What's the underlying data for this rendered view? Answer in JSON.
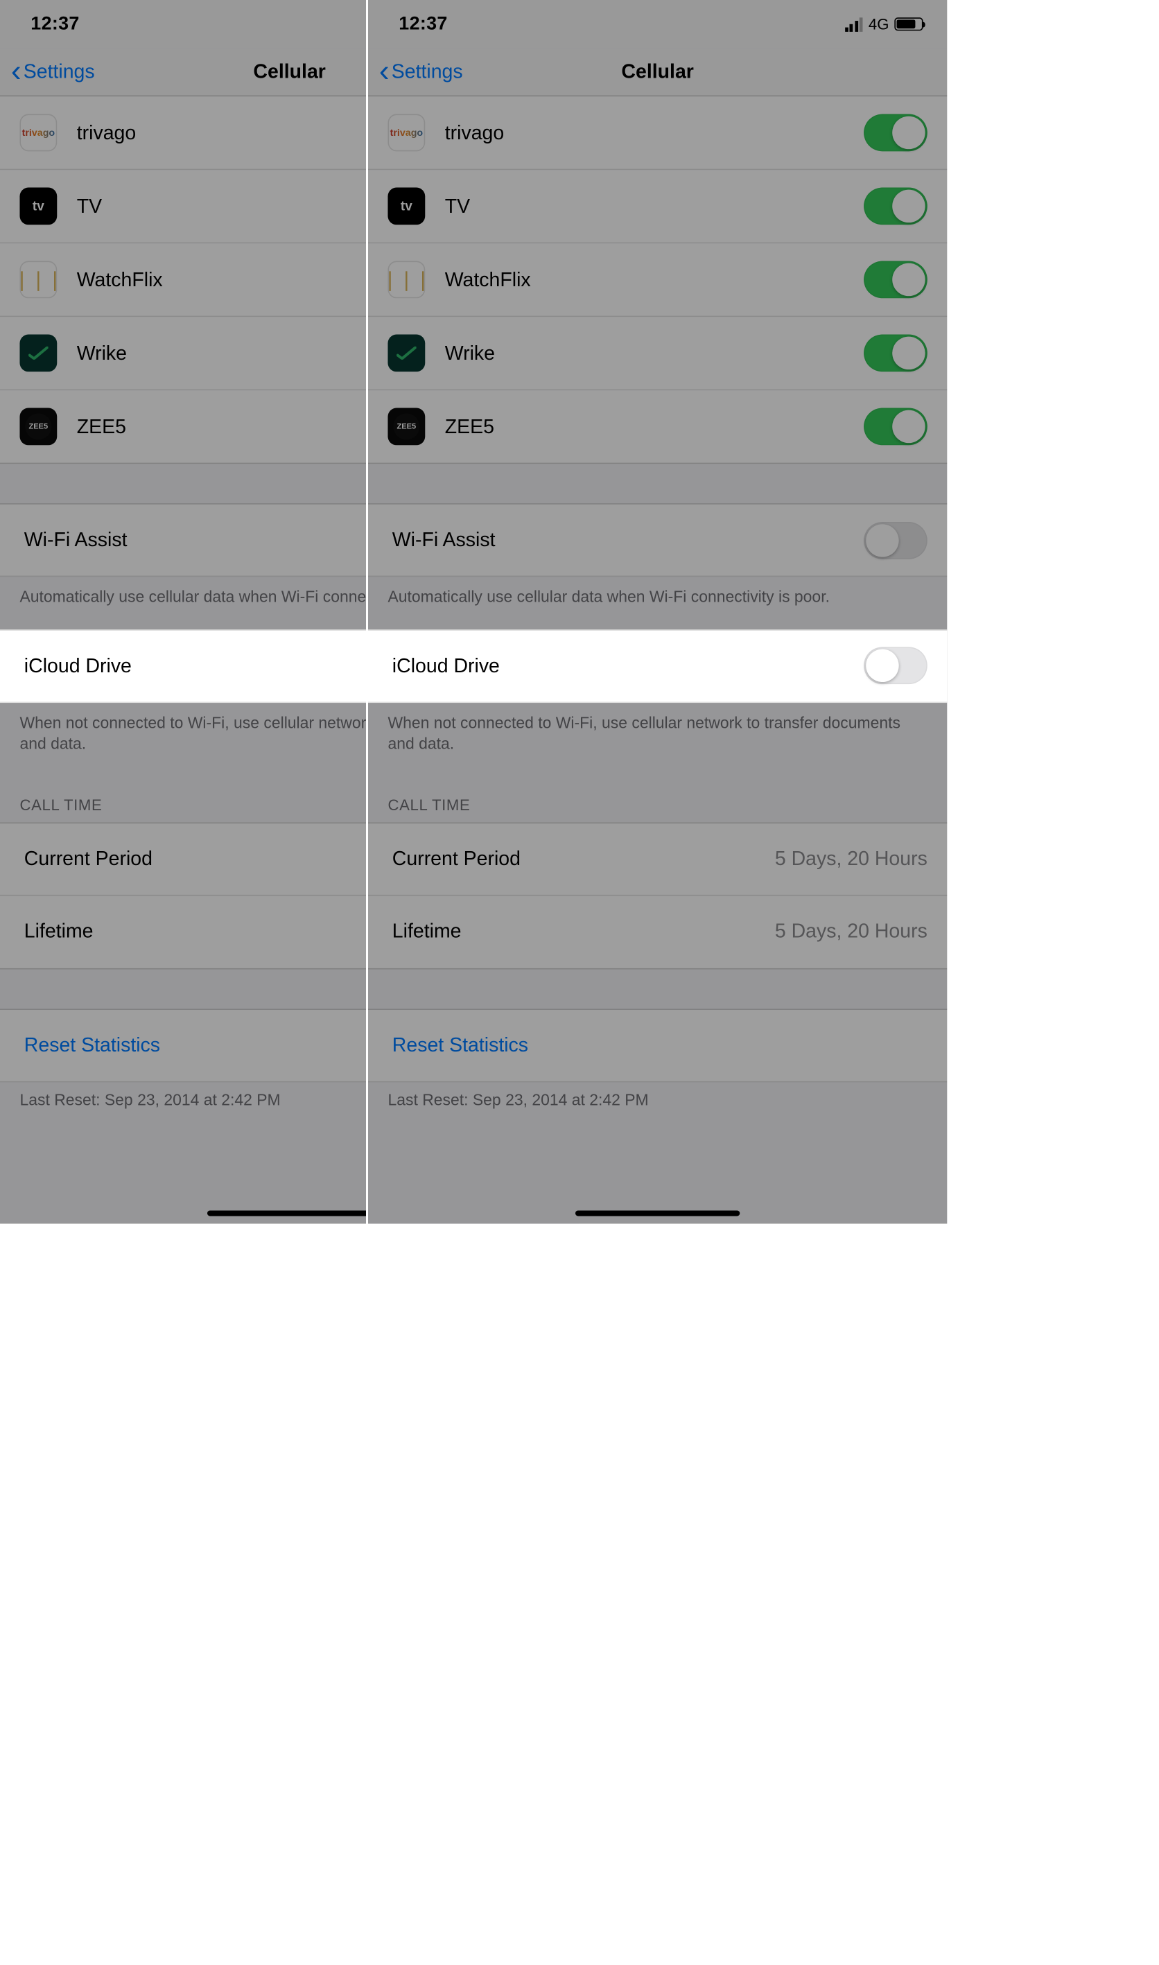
{
  "statusbar": {
    "time": "12:37",
    "network": "4G"
  },
  "nav": {
    "back": "Settings",
    "title": "Cellular"
  },
  "apps": [
    {
      "name": "trivago",
      "icon": "trivago"
    },
    {
      "name": "TV",
      "icon": "tv"
    },
    {
      "name": "WatchFlix",
      "icon": "watchflix"
    },
    {
      "name": "Wrike",
      "icon": "wrike"
    },
    {
      "name": "ZEE5",
      "icon": "zee5"
    }
  ],
  "wifi_assist": {
    "label": "Wi-Fi Assist",
    "footer": "Automatically use cellular data when Wi-Fi connectivity is poor."
  },
  "icloud_drive": {
    "label": "iCloud Drive",
    "footer": "When not connected to Wi-Fi, use cellular network to transfer documents and data."
  },
  "call_time": {
    "header": "CALL TIME",
    "current_label": "Current Period",
    "current_value": "5 Days, 20 Hours",
    "lifetime_label": "Lifetime",
    "lifetime_value": "5 Days, 20 Hours"
  },
  "reset": {
    "label": "Reset Statistics",
    "last": "Last Reset: Sep 23, 2014 at 2:42 PM"
  },
  "screens": [
    {
      "icloud_on": true
    },
    {
      "icloud_on": false
    }
  ]
}
